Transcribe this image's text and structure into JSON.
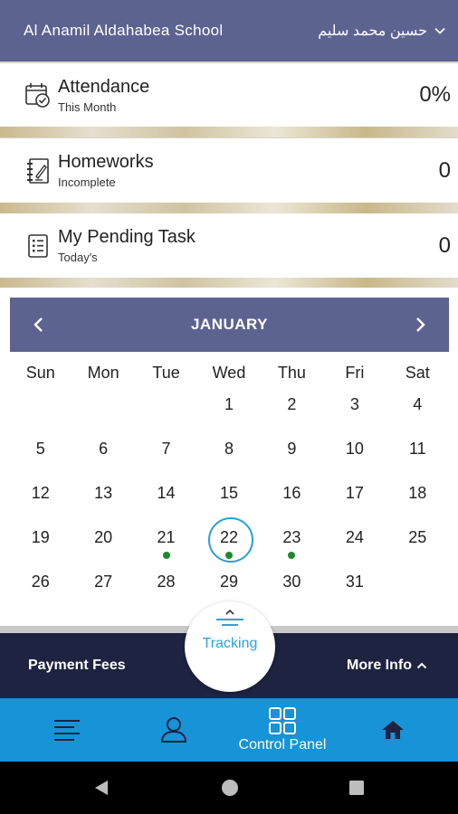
{
  "header": {
    "school_name": "Al Anamil Aldahabea School",
    "user_name": "حسين محمد سليم"
  },
  "stats": [
    {
      "title": "Attendance",
      "subtitle": "This Month",
      "value": "0%",
      "icon": "calendar-check-icon"
    },
    {
      "title": "Homeworks",
      "subtitle": "Incomplete",
      "value": "0",
      "icon": "notebook-icon"
    },
    {
      "title": "My Pending Task",
      "subtitle": "Today's",
      "value": "0",
      "icon": "task-list-icon"
    }
  ],
  "calendar": {
    "month": "JANUARY",
    "weekdays": [
      "Sun",
      "Mon",
      "Tue",
      "Wed",
      "Thu",
      "Fri",
      "Sat"
    ],
    "days": [
      [
        "",
        "",
        "",
        "1",
        "2",
        "3",
        "4"
      ],
      [
        "5",
        "6",
        "7",
        "8",
        "9",
        "10",
        "11"
      ],
      [
        "12",
        "13",
        "14",
        "15",
        "16",
        "17",
        "18"
      ],
      [
        "19",
        "20",
        "21",
        "22",
        "23",
        "24",
        "25"
      ],
      [
        "26",
        "27",
        "28",
        "29",
        "30",
        "31",
        ""
      ]
    ],
    "today": "22",
    "event_days": [
      "21",
      "22",
      "23"
    ],
    "event_color": "#1e8a2e",
    "today_ring_color": "#27a0d8"
  },
  "actions": {
    "payment_fees": "Payment Fees",
    "tracking": "Tracking",
    "more_info": "More Info"
  },
  "bottom_nav": {
    "control_panel": "Control Panel"
  },
  "colors": {
    "header_bg": "#5c6390",
    "action_bar_bg": "#1d2340",
    "bottom_nav_bg": "#1793d8",
    "accent": "#2aa3dc"
  }
}
